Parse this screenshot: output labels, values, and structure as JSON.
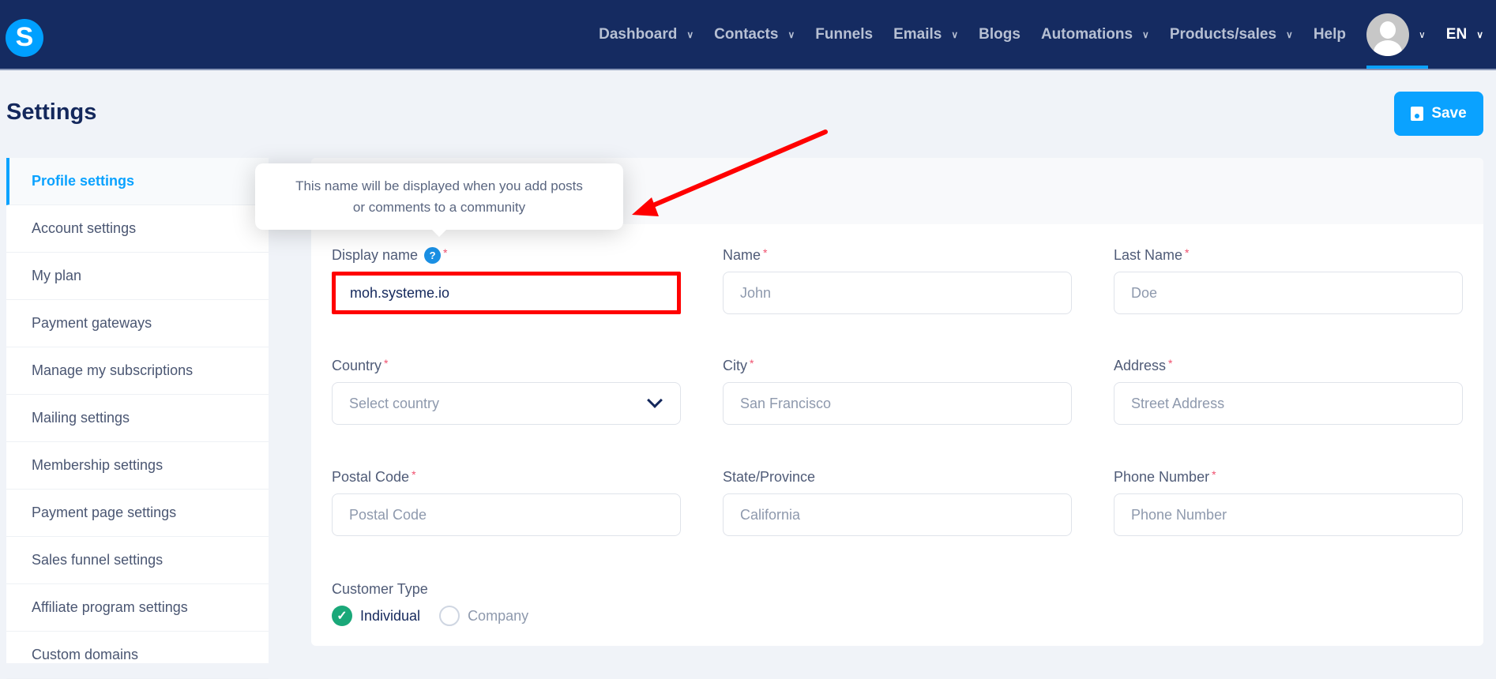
{
  "nav": {
    "logo": "S",
    "items": [
      {
        "label": "Dashboard",
        "dropdown": true
      },
      {
        "label": "Contacts",
        "dropdown": true
      },
      {
        "label": "Funnels",
        "dropdown": false
      },
      {
        "label": "Emails",
        "dropdown": true
      },
      {
        "label": "Blogs",
        "dropdown": false
      },
      {
        "label": "Automations",
        "dropdown": true
      },
      {
        "label": "Products/sales",
        "dropdown": true
      },
      {
        "label": "Help",
        "dropdown": false
      }
    ],
    "language": "EN"
  },
  "page": {
    "title": "Settings",
    "save_label": "Save"
  },
  "sidebar": {
    "items": [
      "Profile settings",
      "Account settings",
      "My plan",
      "Payment gateways",
      "Manage my subscriptions",
      "Mailing settings",
      "Membership settings",
      "Payment page settings",
      "Sales funnel settings",
      "Affiliate program settings",
      "Custom domains"
    ],
    "active": "Profile settings"
  },
  "tooltip": {
    "text": "This name will be displayed when you add posts or comments to a community"
  },
  "form": {
    "display_name": {
      "label": "Display name",
      "help": "?",
      "value": "moh.systeme.io",
      "required": "*"
    },
    "name": {
      "label": "Name",
      "placeholder": "John",
      "required": "*"
    },
    "last_name": {
      "label": "Last Name",
      "placeholder": "Doe",
      "required": "*"
    },
    "country": {
      "label": "Country",
      "placeholder": "Select country",
      "required": "*"
    },
    "city": {
      "label": "City",
      "placeholder": "San Francisco",
      "required": "*"
    },
    "address": {
      "label": "Address",
      "placeholder": "Street Address",
      "required": "*"
    },
    "postal": {
      "label": "Postal Code",
      "placeholder": "Postal Code",
      "required": "*"
    },
    "state": {
      "label": "State/Province",
      "placeholder": "California"
    },
    "phone": {
      "label": "Phone Number",
      "placeholder": "Phone Number",
      "required": "*"
    },
    "customer_type": {
      "label": "Customer Type",
      "options": [
        "Individual",
        "Company"
      ],
      "selected": "Individual",
      "check": "✓"
    }
  },
  "colors": {
    "nav": "#152b61",
    "accent": "#0aa2ff",
    "annotation": "#ff0000",
    "success": "#1aa879"
  }
}
